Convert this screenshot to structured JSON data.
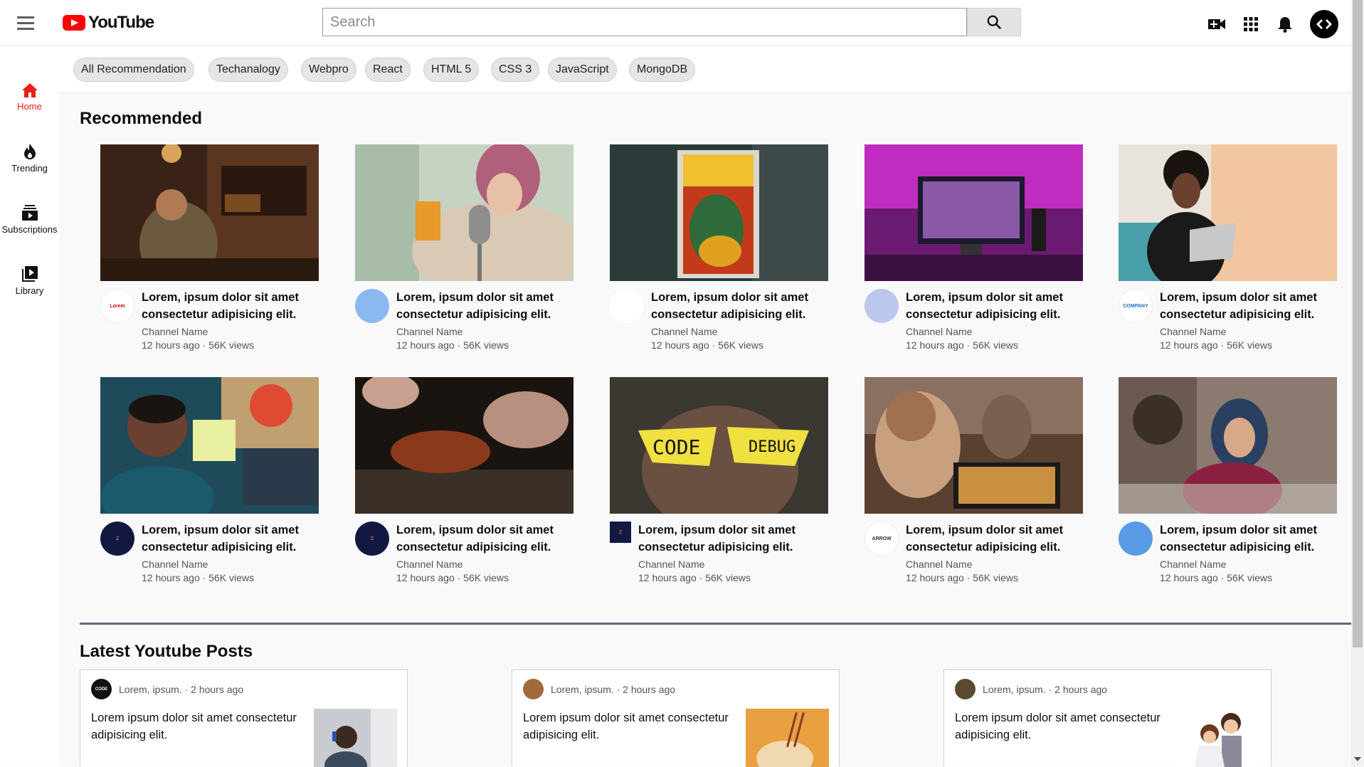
{
  "header": {
    "logo_text": "YouTube",
    "search_placeholder": "Search",
    "icons": [
      "menu-icon",
      "search-icon",
      "video-camera-icon",
      "apps-grid-icon",
      "bell-icon",
      "avatar-code-icon"
    ]
  },
  "sidebar": {
    "items": [
      {
        "label": "Home",
        "icon": "home-icon"
      },
      {
        "label": "Trending",
        "icon": "fire-icon"
      },
      {
        "label": "Subscriptions",
        "icon": "subscriptions-icon"
      },
      {
        "label": "Library",
        "icon": "library-icon"
      }
    ]
  },
  "chips": [
    "All Recommendation",
    "Techanalogy",
    "Webpro",
    "React",
    "HTML 5",
    "CSS 3",
    "JavaScript",
    "MongoDB"
  ],
  "recommended": {
    "title": "Recommended",
    "videos": [
      {
        "title": "Lorem, ipsum dolor sit amet consectetur adipisicing elit.",
        "channel": "Channel Name",
        "stats": "12 hours ago · 56K views",
        "avatar_text": "Lorem"
      },
      {
        "title": "Lorem, ipsum dolor sit amet consectetur adipisicing elit.",
        "channel": "Channel Name",
        "stats": "12 hours ago · 56K views",
        "avatar_text": ""
      },
      {
        "title": "Lorem, ipsum dolor sit amet consectetur adipisicing elit.",
        "channel": "Channel Name",
        "stats": "12 hours ago · 56K views",
        "avatar_text": ""
      },
      {
        "title": "Lorem, ipsum dolor sit amet consectetur adipisicing elit.",
        "channel": "Channel Name",
        "stats": "12 hours ago · 56K views",
        "avatar_text": ""
      },
      {
        "title": "Lorem, ipsum dolor sit amet consectetur adipisicing elit.",
        "channel": "Channel Name",
        "stats": "12 hours ago · 56K views",
        "avatar_text": "COMPANY"
      },
      {
        "title": "Lorem, ipsum dolor sit amet consectetur adipisicing elit.",
        "channel": "Channel Name",
        "stats": "12 hours ago · 56K views",
        "avatar_text": "Z"
      },
      {
        "title": "Lorem, ipsum dolor sit amet consectetur adipisicing elit.",
        "channel": "Channel Name",
        "stats": "12 hours ago · 56K views",
        "avatar_text": "Z"
      },
      {
        "title": "Lorem, ipsum dolor sit amet consectetur adipisicing elit.",
        "channel": "Channel Name",
        "stats": "12 hours ago · 56K views",
        "avatar_text": "Z"
      },
      {
        "title": "Lorem, ipsum dolor sit amet consectetur adipisicing elit.",
        "channel": "Channel Name",
        "stats": "12 hours ago · 56K views",
        "avatar_text": "ARROW"
      },
      {
        "title": "Lorem, ipsum dolor sit amet consectetur adipisicing elit.",
        "channel": "Channel Name",
        "stats": "12 hours ago · 56K views",
        "avatar_text": ""
      }
    ]
  },
  "latest": {
    "title": "Latest Youtube Posts",
    "posts": [
      {
        "meta": "Lorem, ipsum. · 2 hours ago",
        "text": "Lorem ipsum dolor sit amet consectetur adipisicing elit.",
        "avatar_text": "CODE"
      },
      {
        "meta": "Lorem, ipsum. · 2 hours ago",
        "text": "Lorem ipsum dolor sit amet consectetur adipisicing elit.",
        "avatar_text": ""
      },
      {
        "meta": "Lorem, ipsum. · 2 hours ago",
        "text": "Lorem ipsum dolor sit amet consectetur adipisicing elit.",
        "avatar_text": ""
      }
    ]
  },
  "colors": {
    "accent": "#ff0000",
    "active_sidebar": "#e62117",
    "background": "#f9f9f9"
  }
}
